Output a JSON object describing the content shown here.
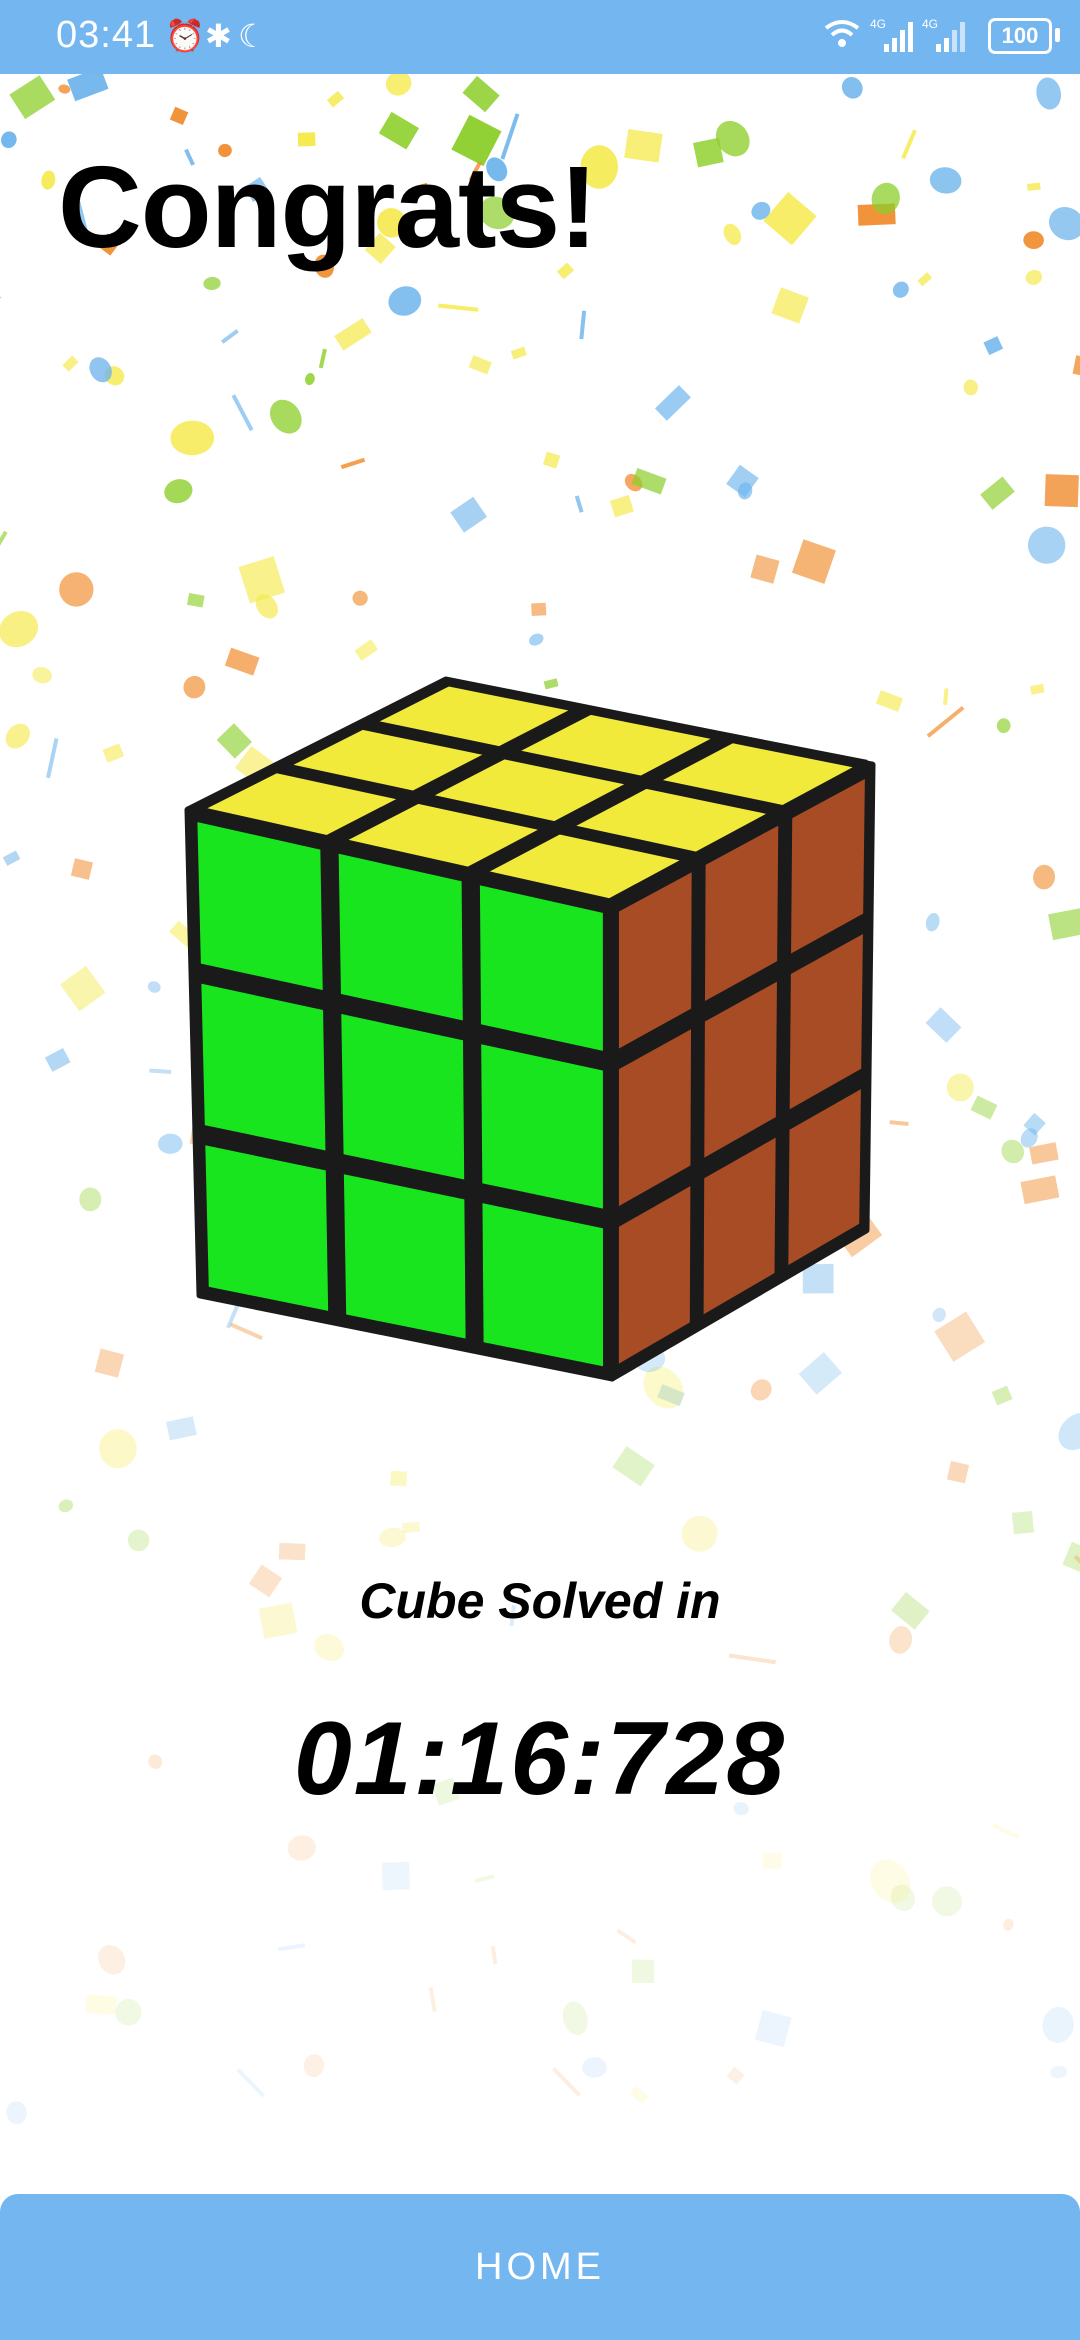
{
  "status_bar": {
    "time": "03:41",
    "icons": [
      "alarm-icon",
      "bluetooth-icon",
      "moon-icon",
      "wifi-icon",
      "signal-4g-icon",
      "signal-4g-icon"
    ],
    "battery": "100"
  },
  "title": "Congrats!",
  "result": {
    "label": "Cube Solved in",
    "time": "01:16:728"
  },
  "home_button": {
    "label": "HOME"
  },
  "colors": {
    "accent": "#74b6f0",
    "cube_top": "#f2ea3a",
    "cube_front": "#18e51e",
    "cube_side": "#a84c26",
    "cube_frame": "#1a1a1a"
  }
}
